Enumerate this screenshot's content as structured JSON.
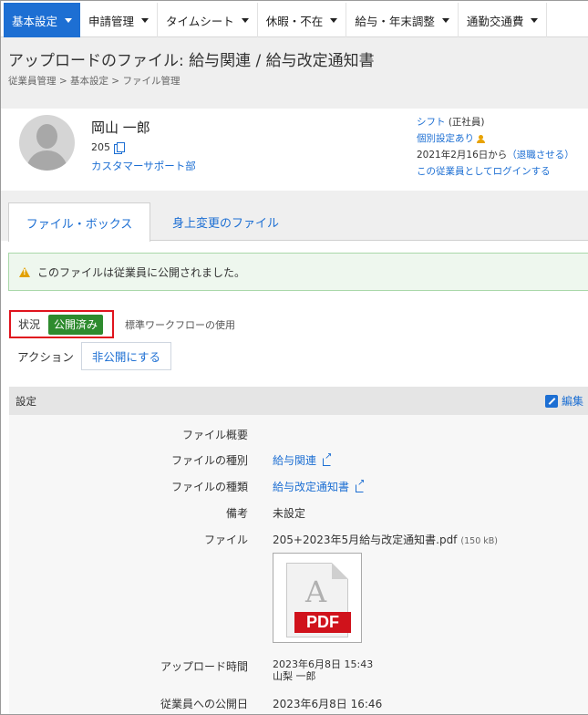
{
  "nav": {
    "items": [
      {
        "label": "基本設定"
      },
      {
        "label": "申請管理"
      },
      {
        "label": "タイムシート"
      },
      {
        "label": "休暇・不在"
      },
      {
        "label": "給与・年末調整"
      },
      {
        "label": "通勤交通費"
      }
    ]
  },
  "page": {
    "title": "アップロードのファイル: 給与関連 / 給与改定通知書",
    "breadcrumb": "従業員管理 > 基本設定 > ファイル管理"
  },
  "employee": {
    "name": "岡山 一郎",
    "id": "205",
    "department": "カスタマーサポート部",
    "shift_link": "シフト",
    "employment_type": " (正社員)",
    "personal_settings": "個別設定あり",
    "since": "2021年2月16日から",
    "retire_link": "（退職させる）",
    "login_as": "この従業員としてログインする"
  },
  "tabs": {
    "file_box": "ファイル・ボックス",
    "personnel_change": "身上変更のファイル"
  },
  "notice": {
    "text": "このファイルは従業員に公開されました。"
  },
  "status": {
    "label": "状況",
    "badge": "公開済み",
    "workflow": "標準ワークフローの使用"
  },
  "action": {
    "label": "アクション",
    "unpublish_button": "非公開にする"
  },
  "settings": {
    "title": "設定",
    "edit": "編集",
    "rows": {
      "summary_label": "ファイル概要",
      "category_label": "ファイルの種別",
      "category_value": "給与関連",
      "type_label": "ファイルの種類",
      "type_value": "給与改定通知書",
      "note_label": "備考",
      "note_value": "未設定",
      "file_label": "ファイル",
      "file_name": "205+2023年5月給与改定通知書.pdf",
      "file_size": "(150 kB)",
      "pdf_text": "PDF",
      "upload_label": "アップロード時間",
      "upload_time": "2023年6月8日 15:43",
      "upload_by": "山梨 一郎",
      "publish_label": "従業員への公開日",
      "publish_time": "2023年6月8日 16:46"
    }
  },
  "colors": {
    "accent": "#1d6fd3",
    "badge_green": "#2e8b2e",
    "highlight_red": "#e0141e",
    "notice_bg": "#eef7ee",
    "pdf_red": "#d0121b"
  }
}
